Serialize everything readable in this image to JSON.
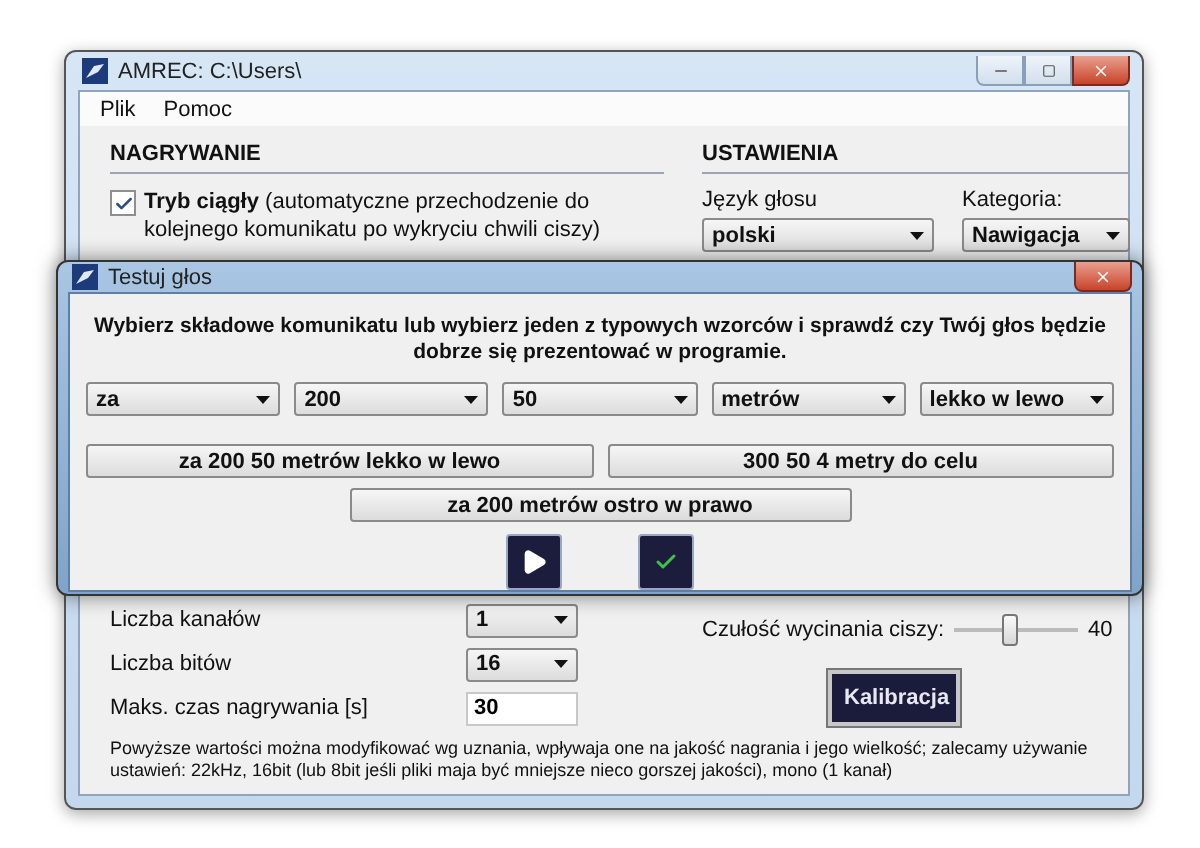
{
  "main_window": {
    "title": "AMREC: C:\\Users\\",
    "menu": [
      "Plik",
      "Pomoc"
    ],
    "recording": {
      "heading": "NAGRYWANIE",
      "continuous": {
        "text": "**Tryb ciągły**  (automatyczne przechodzenie do kolejnego komunikatu po wykryciu chwili ciszy)",
        "checked": true
      },
      "fields": [
        {
          "label": "Liczba kanałów",
          "kind": "dropdown",
          "value": "1"
        },
        {
          "label": "Liczba bitów",
          "kind": "dropdown",
          "value": "16"
        },
        {
          "label": "Maks. czas nagrywania [s]",
          "kind": "input",
          "value": "30"
        }
      ],
      "note": "Powyższe wartości można modyfikować wg uznania, wpływaja one na jakość nagrania i jego wielkość; zalecamy używanie ustawień: 22kHz, 16bit (lub 8bit jeśli pliki maja być mniejsze nieco gorszej jakości), mono (1 kanał)"
    },
    "settings": {
      "heading": "USTAWIENIA",
      "voice_language": {
        "label": "Język głosu",
        "value": "polski"
      },
      "category": {
        "label": "Kategoria:",
        "value": "Nawigacja"
      },
      "silence": {
        "label": "Czułość wycinania ciszy:",
        "level": 0.45,
        "reading": "40"
      },
      "calibrate_button": "Kalibracja"
    }
  },
  "dialog": {
    "title": "Testuj głos",
    "instructions": "Wybierz składowe  komunikatu lub wybierz jeden z typowych wzorców i sprawdź czy Twój głos będzie dobrze się prezentować w programie.",
    "selectors": [
      "za",
      "200",
      "50",
      "metrów",
      "lekko w lewo"
    ],
    "presets": [
      "za 200 50 metrów lekko w lewo",
      "300 50 4 metry do celu",
      "za 200 metrów ostro w prawo"
    ]
  }
}
